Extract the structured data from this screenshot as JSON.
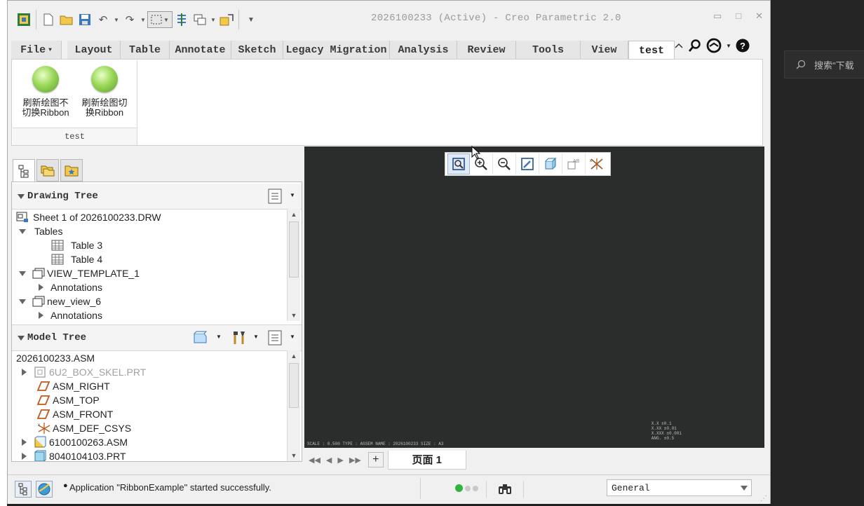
{
  "window": {
    "title": "2026100233 (Active) - Creo Parametric 2.0"
  },
  "background": {
    "search_placeholder": "搜索\"下载"
  },
  "tabs": [
    {
      "label": "File",
      "w": 72
    },
    {
      "label": "Layout"
    },
    {
      "label": "Table"
    },
    {
      "label": "Annotate"
    },
    {
      "label": "Sketch"
    },
    {
      "label": "Legacy Migration"
    },
    {
      "label": "Analysis"
    },
    {
      "label": "Review"
    },
    {
      "label": "Tools"
    },
    {
      "label": "View"
    },
    {
      "label": "test"
    }
  ],
  "ribbon": {
    "buttons": [
      {
        "label_line1": "刷新绘图不",
        "label_line2": "切换Ribbon"
      },
      {
        "label_line1": "刷新绘图切",
        "label_line2": "换Ribbon"
      }
    ],
    "group_name": "test"
  },
  "drawing_tree": {
    "title": "Drawing Tree",
    "items": [
      {
        "text": "Sheet 1 of 2026100233.DRW"
      },
      {
        "text": "Tables"
      },
      {
        "text": "Table 3"
      },
      {
        "text": "Table 4"
      },
      {
        "text": "VIEW_TEMPLATE_1"
      },
      {
        "text": "Annotations"
      },
      {
        "text": "new_view_6"
      },
      {
        "text": "Annotations"
      }
    ]
  },
  "model_tree": {
    "title": "Model Tree",
    "items": [
      {
        "text": "2026100233.ASM"
      },
      {
        "text": "6U2_BOX_SKEL.PRT"
      },
      {
        "text": "ASM_RIGHT"
      },
      {
        "text": "ASM_TOP"
      },
      {
        "text": "ASM_FRONT"
      },
      {
        "text": "ASM_DEF_CSYS"
      },
      {
        "text": "6100100263.ASM"
      },
      {
        "text": "8040104103.PRT"
      }
    ]
  },
  "canvas": {
    "footer": "SCALE : 0.500    TYPE : ASSEM    NAME : 2026100233    SIZE : A3",
    "note_lines": [
      "X.X  ±0.1",
      "X.XX  ±0.01",
      "X.XXX  ±0.001",
      "ANG.  ±0.5"
    ]
  },
  "pagebar": {
    "page_label": "页面 1"
  },
  "status": {
    "message": "Application \"RibbonExample\" started successfully.",
    "filter": "General"
  }
}
